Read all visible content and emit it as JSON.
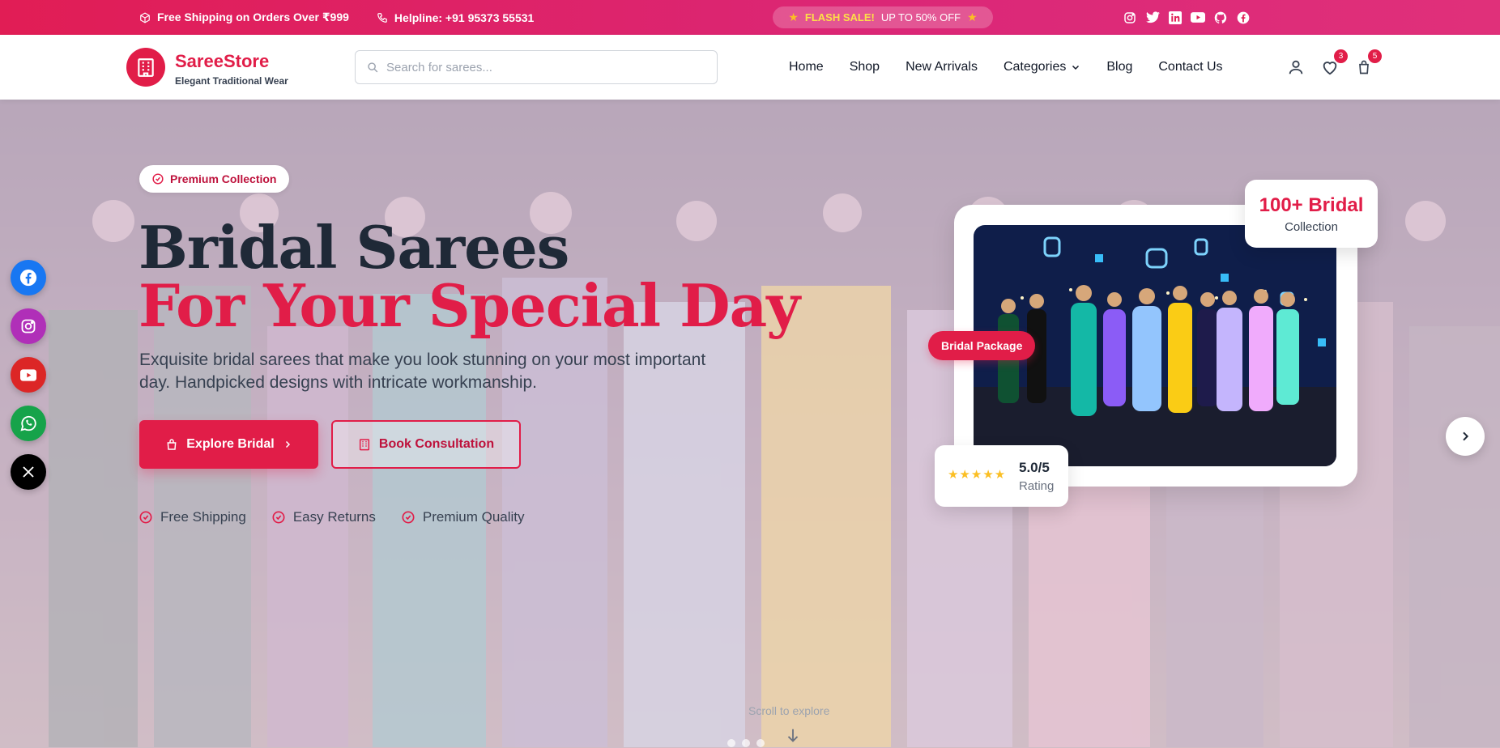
{
  "topbar": {
    "shipping": "Free Shipping on Orders Over ₹999",
    "helpline": "Helpline: +91 95373 55531",
    "flash_label": "FLASH SALE!",
    "flash_offer": "UP TO 50% OFF",
    "social_icons": [
      "instagram-icon",
      "twitter-icon",
      "linkedin-icon",
      "youtube-icon",
      "github-icon",
      "facebook-icon"
    ]
  },
  "header": {
    "brand": "SareeStore",
    "tagline": "Elegant Traditional Wear",
    "search_placeholder": "Search for sarees...",
    "nav": [
      "Home",
      "Shop",
      "New Arrivals",
      "Categories",
      "Blog",
      "Contact Us"
    ],
    "wishlist_count": "3",
    "cart_count": "5"
  },
  "hero": {
    "pill": "Premium Collection",
    "title_line1": "Bridal Sarees",
    "title_line2": "For Your Special Day",
    "description": "Exquisite bridal sarees that make you look stunning on your most important day. Handpicked designs with intricate workmanship.",
    "primary_button": "Explore Bridal",
    "secondary_button": "Book Consultation",
    "features": [
      "Free Shipping",
      "Easy Returns",
      "Premium Quality"
    ],
    "stat_number": "100+ Bridal",
    "stat_label": "Collection",
    "tag": "Bridal Package",
    "rating_value": "5.0/5",
    "rating_label": "Rating",
    "rating_stars": 5,
    "scroll_text": "Scroll to explore"
  },
  "colors": {
    "accent": "#e11d48",
    "facebook": "#1877f2",
    "instagram": "#b02fb8",
    "youtube": "#dc2626",
    "whatsapp": "#16a34a",
    "x": "#000000"
  },
  "floating_social": [
    "facebook-icon",
    "instagram-icon",
    "youtube-icon",
    "whatsapp-icon",
    "x-icon"
  ]
}
